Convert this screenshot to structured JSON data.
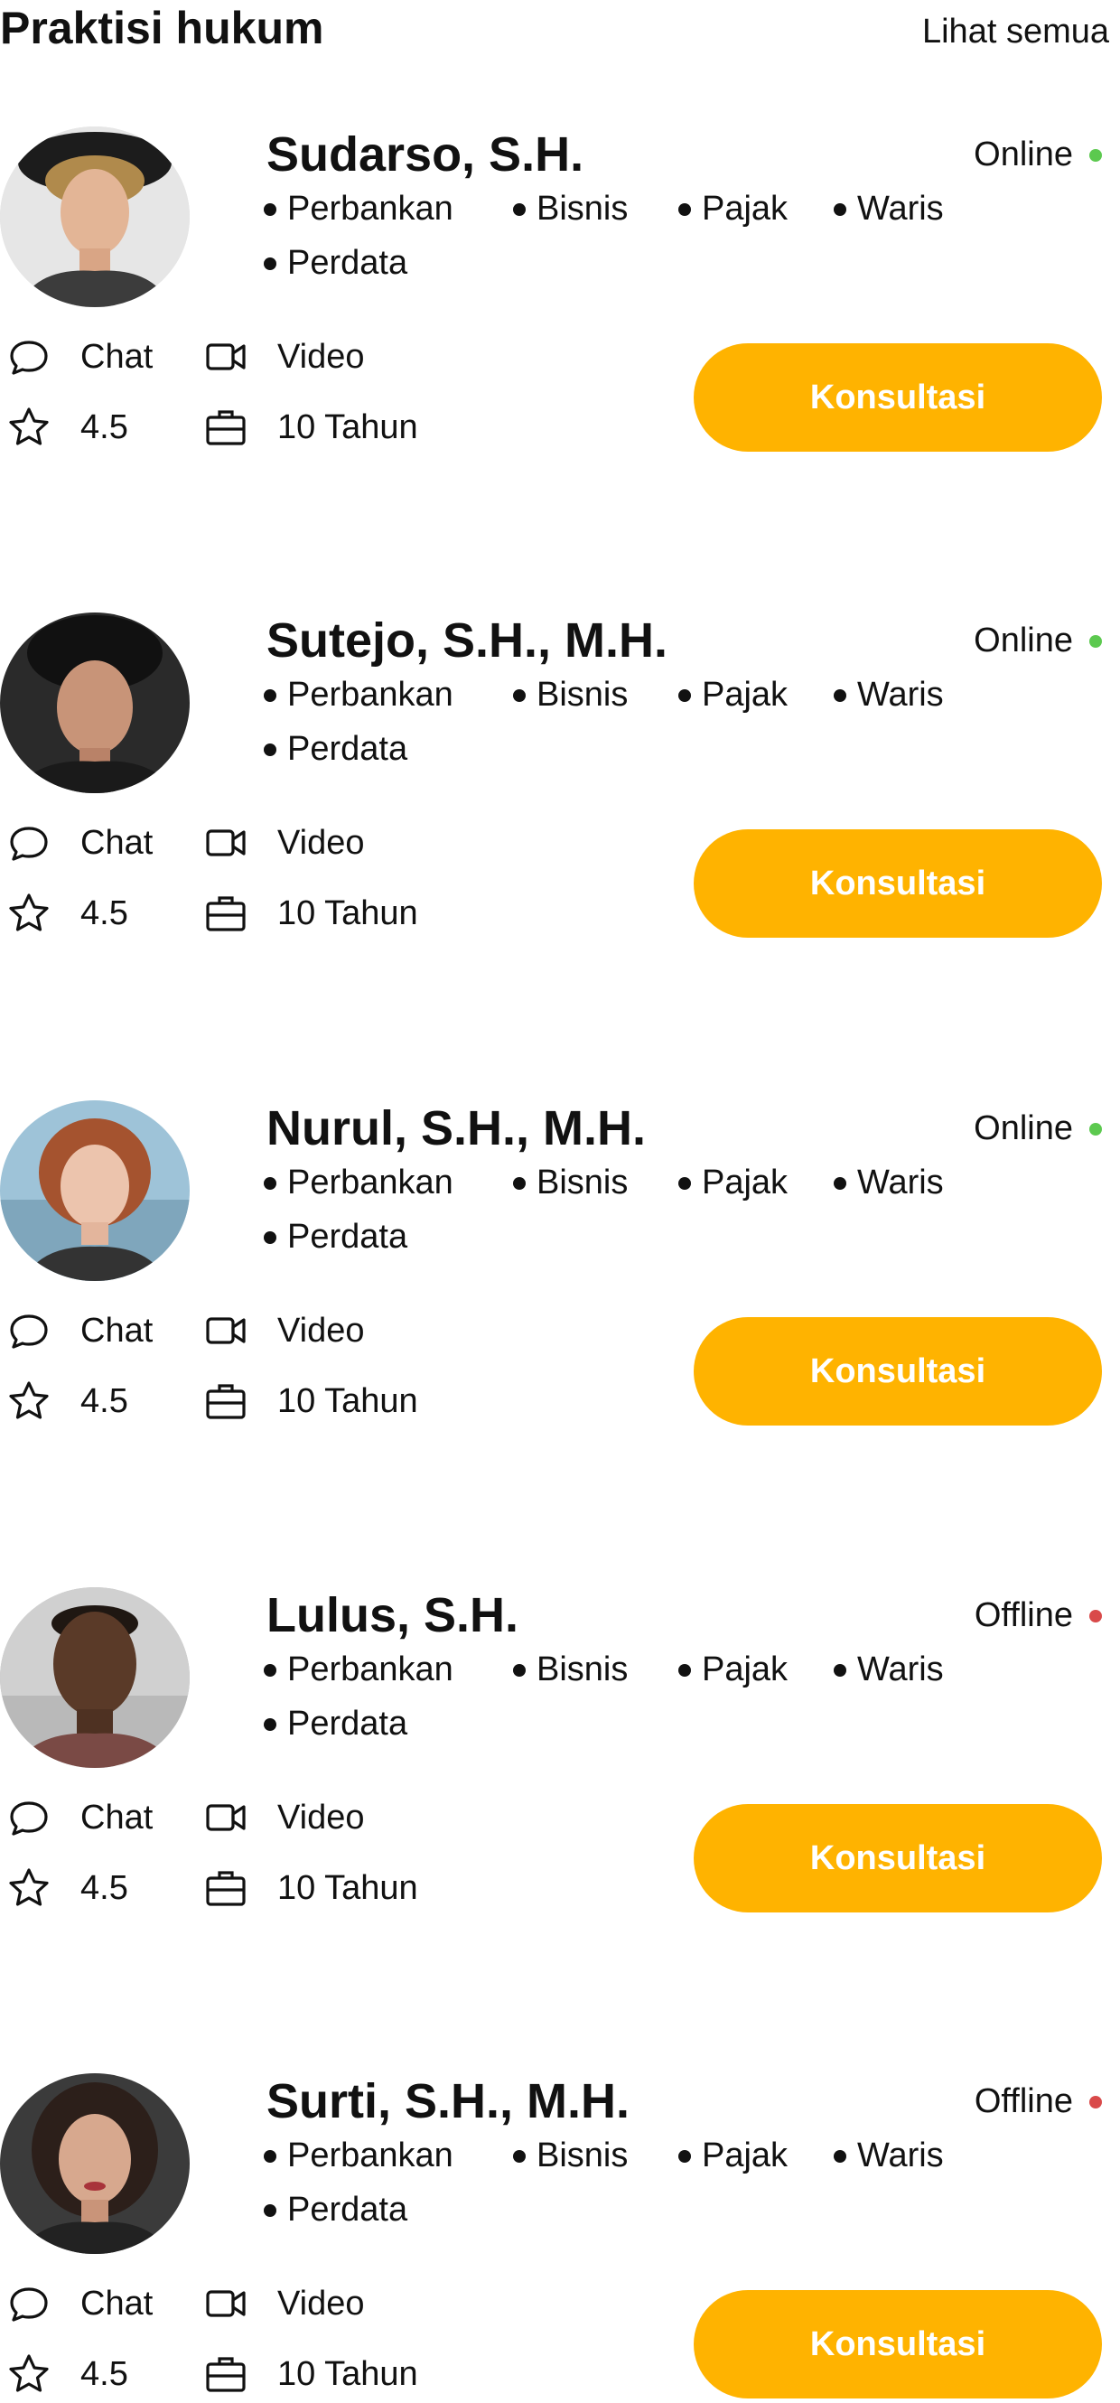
{
  "header": {
    "title": "Praktisi hukum",
    "see_all": "Lihat semua"
  },
  "colors": {
    "accent": "#ffb300",
    "online": "#5cc94f",
    "offline": "#d94a4a"
  },
  "lawyers": [
    {
      "name": "Sudarso, S.H.",
      "status": "Online",
      "tags": [
        "Perbankan",
        "Bisnis",
        "Pajak",
        "Waris",
        "Perdata"
      ],
      "chat_label": "Chat",
      "video_label": "Video",
      "rating": "4.5",
      "experience": "10 Tahun",
      "button_label": "Konsultasi"
    },
    {
      "name": "Sutejo, S.H., M.H.",
      "status": "Online",
      "tags": [
        "Perbankan",
        "Bisnis",
        "Pajak",
        "Waris",
        "Perdata"
      ],
      "chat_label": "Chat",
      "video_label": "Video",
      "rating": "4.5",
      "experience": "10 Tahun",
      "button_label": "Konsultasi"
    },
    {
      "name": "Nurul, S.H., M.H.",
      "status": "Online",
      "tags": [
        "Perbankan",
        "Bisnis",
        "Pajak",
        "Waris",
        "Perdata"
      ],
      "chat_label": "Chat",
      "video_label": "Video",
      "rating": "4.5",
      "experience": "10 Tahun",
      "button_label": "Konsultasi"
    },
    {
      "name": "Lulus, S.H.",
      "status": "Offline",
      "tags": [
        "Perbankan",
        "Bisnis",
        "Pajak",
        "Waris",
        "Perdata"
      ],
      "chat_label": "Chat",
      "video_label": "Video",
      "rating": "4.5",
      "experience": "10 Tahun",
      "button_label": "Konsultasi"
    },
    {
      "name": "Surti, S.H., M.H.",
      "status": "Offline",
      "tags": [
        "Perbankan",
        "Bisnis",
        "Pajak",
        "Waris",
        "Perdata"
      ],
      "chat_label": "Chat",
      "video_label": "Video",
      "rating": "4.5",
      "experience": "10 Tahun",
      "button_label": "Konsultasi"
    }
  ]
}
